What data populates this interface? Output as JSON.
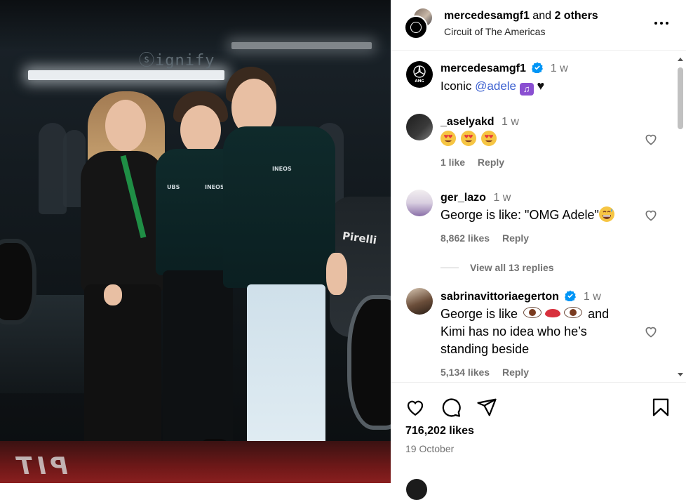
{
  "post": {
    "header": {
      "username": "mercedesamgf1",
      "and_text": "and",
      "others": "2 others",
      "location": "Circuit of The Americas",
      "more_icon": "more-horizontal-icon"
    },
    "photo": {
      "sign_text": "ⓢignify"
    },
    "caption": {
      "username": "mercedesamgf1",
      "time": "1 w",
      "text_prefix": "Iconic",
      "mention": "@adele",
      "emojis": [
        "purple-music-notes-emoji",
        "black-heart-emoji"
      ]
    },
    "comments": [
      {
        "username": "_aselyakd",
        "time": "1 w",
        "emojis": [
          "heart-eyes-emoji",
          "heart-eyes-emoji",
          "heart-eyes-emoji"
        ],
        "likes": "1 like",
        "reply": "Reply"
      },
      {
        "username": "ger_lazo",
        "time": "1 w",
        "text": "George is like: \"OMG Adele\"",
        "emoji": "grinning-sweat-emoji",
        "likes": "8,862 likes",
        "reply": "Reply",
        "view_replies": "View all 13 replies"
      },
      {
        "username": "sabrinavittoriaegerton",
        "time": "1 w",
        "text_line1_prefix": "George is like",
        "text_line1_suffix": "and",
        "text_line2": "Kimi has no idea who he’s",
        "text_line3": "standing beside",
        "likes": "5,134 likes",
        "reply": "Reply"
      }
    ],
    "actions": {
      "icons": [
        "heart-icon",
        "comment-icon",
        "share-icon",
        "bookmark-icon"
      ],
      "likes": "716,202 likes",
      "date": "19 October"
    }
  },
  "colors": {
    "mention": "#3a5fd0",
    "verified": "#0095f6",
    "muted": "#737373"
  }
}
